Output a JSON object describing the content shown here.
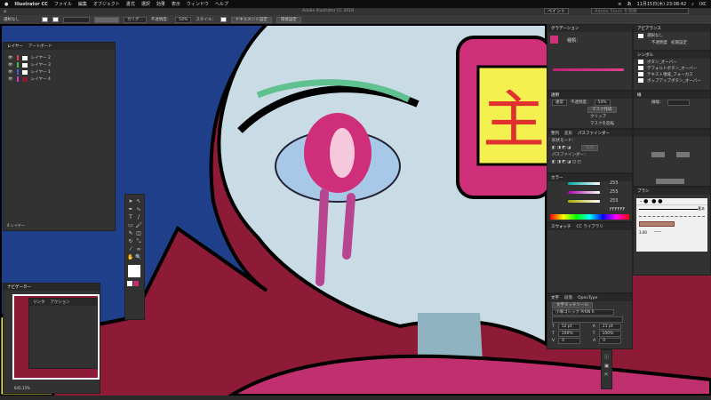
{
  "menubar": {
    "apple": "",
    "app": "Illustrator CC",
    "items": [
      "ファイル",
      "編集",
      "オブジェクト",
      "書式",
      "選択",
      "効果",
      "表示",
      "ウィンドウ",
      "ヘルプ"
    ],
    "clock": "11月15日(木) 23:08:42",
    "input": "あ",
    "user": "IXC"
  },
  "appbar": {
    "title": "Adobe Illustrator CC 2018",
    "workspace": "ペイント",
    "search_placeholder": "Adobe Stock を検索"
  },
  "control": {
    "selection": "選択なし",
    "brush": "カリグ...",
    "opacity_label": "不透明度：",
    "opacity": "54%",
    "style_label": "スタイル：",
    "doc_setup": "ドキュメント設定",
    "prefs": "環境設定"
  },
  "layers": {
    "tabs": [
      "レイヤー",
      "アートボード"
    ],
    "items": [
      {
        "name": "レイヤー 2",
        "color": "#e04040"
      },
      {
        "name": "レイヤー 3",
        "color": "#40c040"
      },
      {
        "name": "レイヤー 1",
        "color": "#4060e0"
      },
      {
        "name": "レイヤー 4",
        "color": "#c040c0"
      }
    ],
    "count": "4 レイヤー"
  },
  "navigator": {
    "tab": "ナビゲーター",
    "zoom": "645.15%"
  },
  "links": {
    "tabs": [
      "リンク",
      "アクション"
    ]
  },
  "gradient": {
    "tab": "グラデーション",
    "type_label": "種類："
  },
  "transparency": {
    "tab": "透明",
    "mode": "通常",
    "opacity_label": "不透明度：",
    "opacity": "54%",
    "mask_button": "マスク作成",
    "clip": "クリップ",
    "invert": "マスクを反転"
  },
  "pathfinder": {
    "tabs": [
      "整列",
      "変形",
      "パスファインダー"
    ],
    "shape_mode": "形状モード：",
    "expand": "拡張",
    "pathfinder_label": "パスファインダー："
  },
  "color": {
    "tab": "カラー",
    "r": "255",
    "g": "255",
    "b": "255",
    "hex": "FFFFFF"
  },
  "swatches": {
    "tabs": [
      "スウォッチ",
      "CC ライブラリ"
    ]
  },
  "character": {
    "tabs": [
      "文字",
      "段落",
      "OpenType"
    ],
    "touch_tool": "文字タッチツール",
    "font": "小塚ゴシック Pr6N R",
    "size": "12 pt",
    "leading": "21 pt",
    "vscale": "100%",
    "hscale": "100%",
    "kerning": "0",
    "tracking": "0"
  },
  "appearance": {
    "tab": "アピアランス",
    "title": "選択なし",
    "opacity_label": "不透明度",
    "opacity_value": "初期設定"
  },
  "symbols": {
    "tab": "シンボル",
    "items": [
      "ボタン_オーバー",
      "デフォルトボタン_オーバー",
      "テキスト領域_フォーカス",
      "ポップアップボタン_オーバー"
    ]
  },
  "stroke": {
    "tab": "線",
    "weight_label": "線幅："
  },
  "brush": {
    "tab": "ブラシ",
    "basic": "基本",
    "size": "3.00"
  },
  "artwork": {
    "sign": "主"
  },
  "colors": {
    "bg": "#8d1a36",
    "hair": "#1f3f8a",
    "face": "#c9dbe4",
    "accent": "#d0307a",
    "yellow": "#f4f050"
  }
}
